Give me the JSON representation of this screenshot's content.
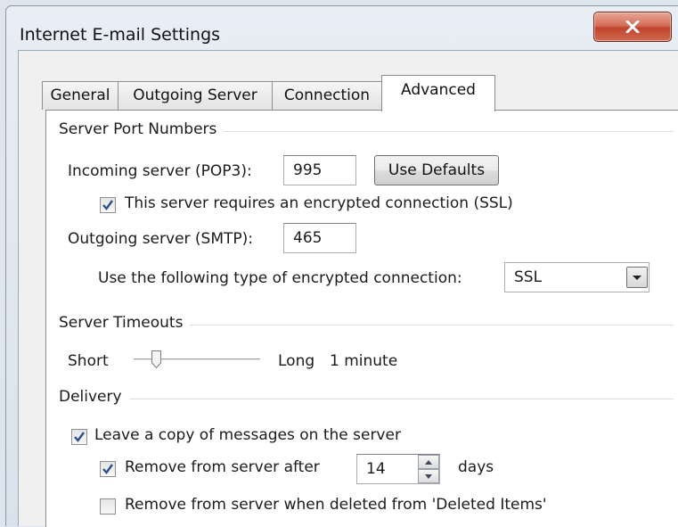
{
  "window": {
    "title": "Internet E-mail Settings",
    "close_glyph": "✕"
  },
  "tabs": [
    {
      "label": "General"
    },
    {
      "label": "Outgoing Server"
    },
    {
      "label": "Connection"
    },
    {
      "label": "Advanced",
      "active": true
    }
  ],
  "server_ports": {
    "title": "Server Port Numbers",
    "incoming_label": "Incoming server (POP3):",
    "incoming_value": "995",
    "use_defaults_label": "Use Defaults",
    "ssl_incoming_label": "This server requires an encrypted connection (SSL)",
    "ssl_incoming_checked": true,
    "outgoing_label": "Outgoing server (SMTP):",
    "outgoing_value": "465",
    "encryption_label": "Use the following type of encrypted connection:",
    "encryption_value": "SSL"
  },
  "timeouts": {
    "title": "Server Timeouts",
    "short_label": "Short",
    "long_label": "Long",
    "value_label": "1 minute",
    "slider_level": 0.15
  },
  "delivery": {
    "title": "Delivery",
    "leave_copy_label": "Leave a copy of messages on the server",
    "leave_copy_checked": true,
    "remove_after_label": "Remove from server after",
    "remove_after_checked": true,
    "days_value": "14",
    "days_label": "days",
    "remove_deleted_label": "Remove from server when deleted from 'Deleted Items'",
    "remove_deleted_checked": false
  },
  "colors": {
    "accent": "#c0442b",
    "check": "#2a4f8c"
  }
}
